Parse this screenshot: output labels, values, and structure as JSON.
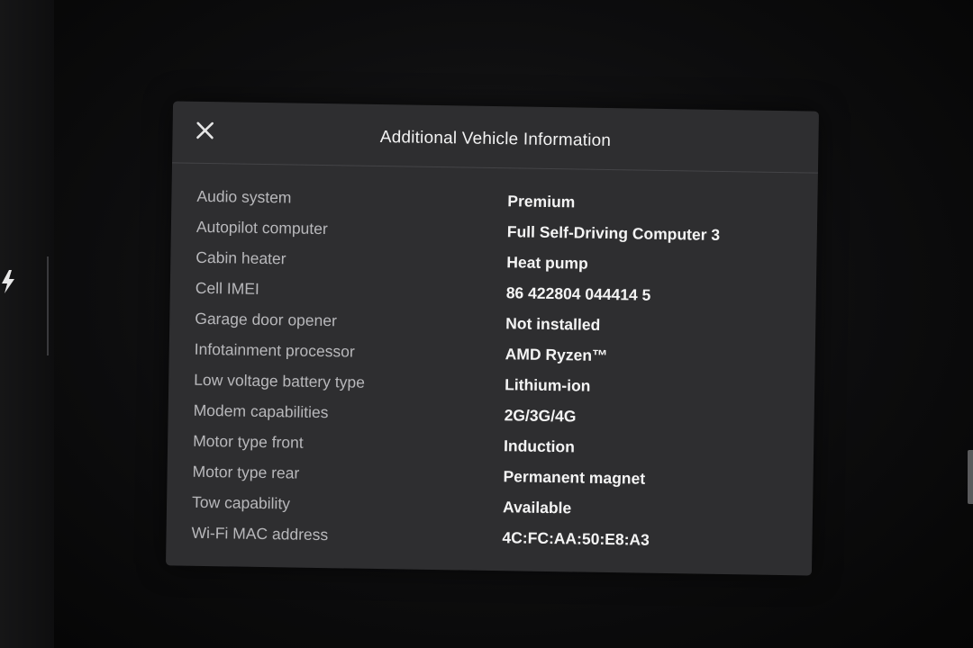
{
  "dialog": {
    "title": "Additional Vehicle Information",
    "close_icon": "close-icon"
  },
  "side": {
    "bolt_icon": "lightning-bolt-icon"
  },
  "rows": [
    {
      "label": "Audio system",
      "value": "Premium"
    },
    {
      "label": "Autopilot computer",
      "value": "Full Self-Driving Computer 3"
    },
    {
      "label": "Cabin heater",
      "value": "Heat pump"
    },
    {
      "label": "Cell IMEI",
      "value": "86 422804 044414 5"
    },
    {
      "label": "Garage door opener",
      "value": "Not installed"
    },
    {
      "label": "Infotainment processor",
      "value": "AMD Ryzen™"
    },
    {
      "label": "Low voltage battery type",
      "value": "Lithium-ion"
    },
    {
      "label": "Modem capabilities",
      "value": "2G/3G/4G"
    },
    {
      "label": "Motor type front",
      "value": "Induction"
    },
    {
      "label": "Motor type rear",
      "value": "Permanent magnet"
    },
    {
      "label": "Tow capability",
      "value": "Available"
    },
    {
      "label": "Wi-Fi MAC address",
      "value": "4C:FC:AA:50:E8:A3"
    }
  ]
}
